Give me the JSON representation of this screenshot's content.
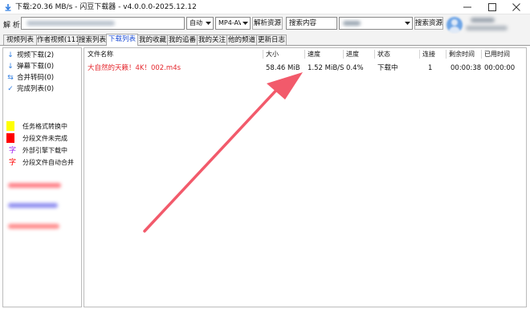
{
  "window": {
    "title": "下载:20.36 MB/s - 闪豆下载器 - v4.0.0.0-2025.12.12",
    "icon": "app-logo-icon"
  },
  "toolbar": {
    "parse_label": "解 析:",
    "quality": "自动",
    "format": "MP4-AVC",
    "parse_button": "解析资源",
    "search_placeholder": "搜索内容",
    "search_button": "搜索资源"
  },
  "tabs": [
    {
      "label": "视频列表"
    },
    {
      "label": "作者视频(111)"
    },
    {
      "label": "搜索列表"
    },
    {
      "label": "下载列表",
      "active": true
    },
    {
      "label": "我的收藏"
    },
    {
      "label": "我的追番"
    },
    {
      "label": "我的关注"
    },
    {
      "label": "他的频道"
    },
    {
      "label": "更新日志"
    }
  ],
  "sidebar": {
    "items": [
      {
        "icon": "download-arrow-icon",
        "glyph": "↓",
        "label": "视频下载(2)"
      },
      {
        "icon": "download-arrow-icon",
        "glyph": "↓",
        "label": "弹幕下载(0)"
      },
      {
        "icon": "merge-icon",
        "glyph": "⇆",
        "label": "合并转码(0)"
      },
      {
        "icon": "check-icon",
        "glyph": "✓",
        "label": "完成列表(0)"
      }
    ],
    "legend": [
      {
        "label": "任务格式转换中",
        "color": "#ffff00"
      },
      {
        "label": "分段文件未完成",
        "color": "#ff0000"
      },
      {
        "label": "外部引擎下载中",
        "glyph": "字",
        "color": "#a020f0"
      },
      {
        "label": "分段文件自动合并",
        "glyph": "字",
        "color": "#ff0000"
      }
    ]
  },
  "table": {
    "columns": [
      "文件名称",
      "大小",
      "速度",
      "进度",
      "状态",
      "连接",
      "剩余时间",
      "已用时间"
    ],
    "rows": [
      {
        "name": "大自然的天籁！4K！002.m4s",
        "size": "58.46 MiB",
        "speed": "1.52 MiB/S",
        "progress": "0.4%",
        "status": "下载中",
        "connections": "1",
        "remaining": "00:00:38",
        "elapsed": "00:00:00"
      }
    ]
  },
  "colors": {
    "accent_tab": "#1f4fd6",
    "filename_text": "#e4262c",
    "annotation_arrow": "#f25a6b"
  }
}
